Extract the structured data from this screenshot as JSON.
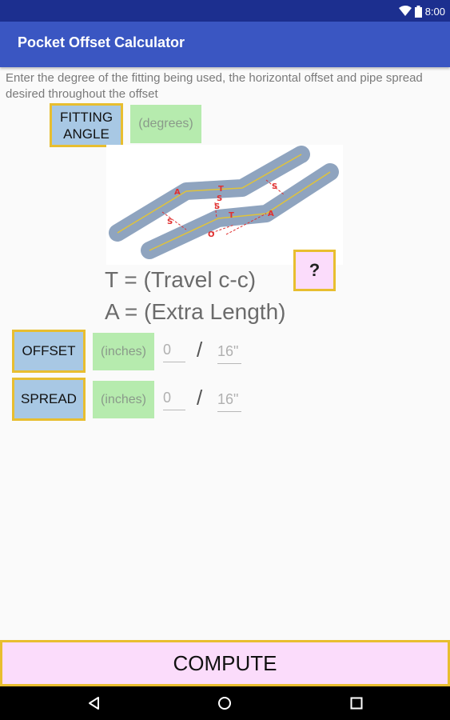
{
  "status_bar": {
    "time": "8:00",
    "icons": [
      "wifi-icon",
      "battery-icon"
    ]
  },
  "app_bar": {
    "title": "Pocket Offset Calculator"
  },
  "instructions": "Enter the degree of the fitting being used, the horizontal offset and pipe spread desired throughout the offset",
  "fitting_angle": {
    "button_label_line1": "FITTING",
    "button_label_line2": "ANGLE",
    "input_placeholder": "(degrees)"
  },
  "diagram": {
    "labels": [
      "A",
      "T",
      "S",
      "S",
      "S",
      "T",
      "A",
      "S",
      "O"
    ]
  },
  "help_button": {
    "label": "?"
  },
  "legend": {
    "travel": "T = (Travel c-c)",
    "extra": "A = (Extra Length)"
  },
  "offset": {
    "button_label": "OFFSET",
    "unit_placeholder": "(inches)",
    "numerator_placeholder": "0",
    "slash": "/",
    "denominator_placeholder": "16\""
  },
  "spread": {
    "button_label": "SPREAD",
    "unit_placeholder": "(inches)",
    "numerator_placeholder": "0",
    "slash": "/",
    "denominator_placeholder": "16\""
  },
  "compute": {
    "label": "COMPUTE"
  },
  "nav": {
    "icons": [
      "back-icon",
      "home-icon",
      "recents-icon"
    ]
  },
  "colors": {
    "status_bar": "#1c2f8f",
    "app_bar": "#3a56c2",
    "button_blue": "#a8c8e4",
    "button_border": "#e8be2f",
    "field_green": "#b6ebae",
    "pink": "#fbdcfb"
  }
}
